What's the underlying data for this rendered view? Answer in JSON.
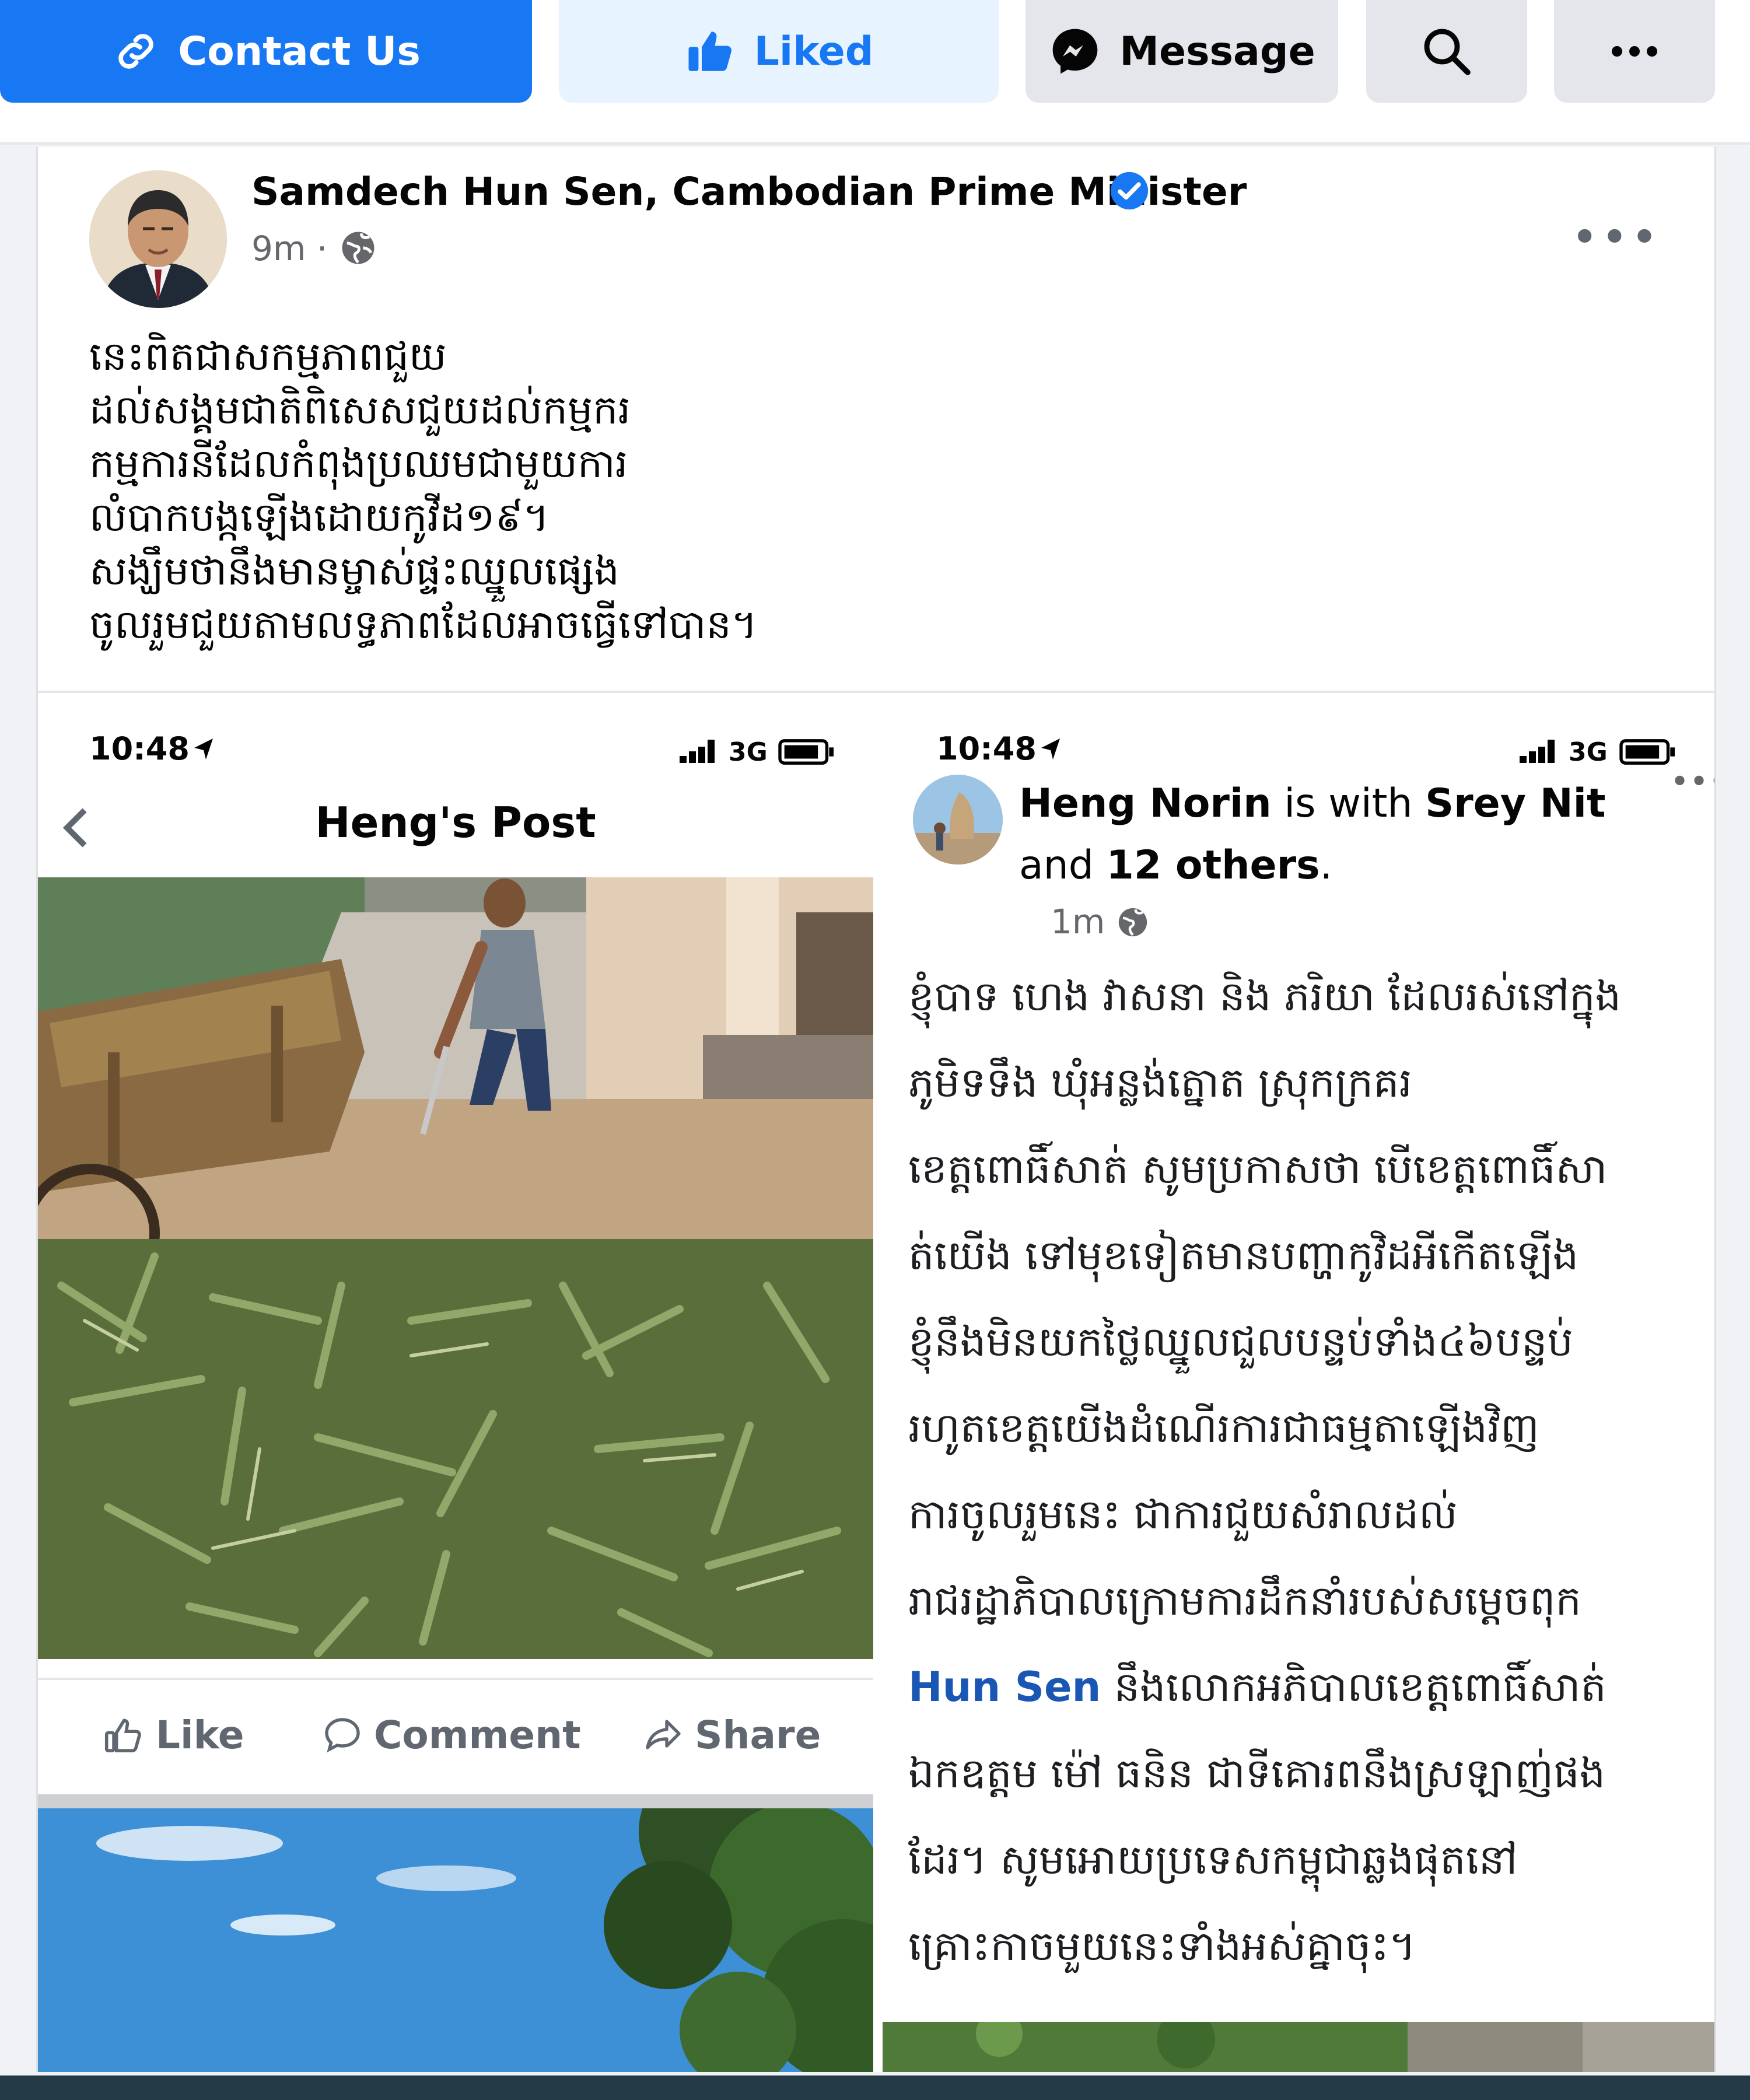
{
  "top_buttons": {
    "contact": "Contact Us",
    "liked": "Liked",
    "message": "Message"
  },
  "post": {
    "author": "Samdech Hun Sen, Cambodian Prime Minister",
    "time": "9m ·",
    "body_lines": [
      "នេះពិតជាសកម្មភាពជួយ",
      "ដល់សង្គមជាតិពិសេសជួយដល់កម្មករ",
      "កម្មការនីដែលកំពុងប្រឈមជាមួយការ",
      "លំបាកបង្កឡើងដោយកូវីដ១៩។",
      "សង្ឃឹមថានឹងមានម្ចាស់ផ្ទះឈ្នួលផ្សេង",
      "ចូលរួមជួយតាមលទ្ធភាពដែលអាចធ្វើទៅបាន។"
    ]
  },
  "left_screenshot": {
    "status_time": "10:48",
    "network": "3G",
    "title": "Heng's Post",
    "actions": {
      "like": "Like",
      "comment": "Comment",
      "share": "Share"
    }
  },
  "right_screenshot": {
    "status_time": "10:48",
    "network": "3G",
    "author": "Heng Norin",
    "with_text": " is with ",
    "tagged": "Srey Nit",
    "and_text": "and ",
    "others": "12 others",
    "period": ".",
    "time": "1m ·",
    "lines": [
      "ខ្ញុំបាទ ហេង វាសនា និង ភរិយា ដែលរស់នៅក្នុង",
      "ភូមិទទឹង ឃុំអន្លង់ត្នោត ស្រុកក្រគរ",
      "ខេត្តពោធិ៍សាត់ សូមប្រកាសថា បើខេត្តពោធិ៍សា",
      "ត់យើង  ទៅមុខទៀតមានបញ្ហាកូវិដអីកើតឡើង",
      "ខ្ញុំនឹងមិនយកថ្លៃឈ្នួលជួលបន្ទប់ទាំង៤៦បន្ទប់",
      "រហូតខេត្តយើងដំណើរការជាធម្មតាឡើងវិញ",
      "ការចូលរួមនេះ ជាការជួយសំរាលដល់",
      "រាជរដ្ឋាភិបាលក្រោមការដឹកនាំរបស់សម្តេចពុក",
      "នឹងលោកអភិបាលខេត្តពោធិ៍សាត់",
      "ឯកឧត្តម ម៉ៅ ធនិន ជាទីគោរពនឹងស្រឡាញ់ផង",
      "ដែរ។ សូមអោយប្រទេសកម្ពុជាឆ្លងផុតនៅ",
      "គ្រោះកាចមួយនេះទាំងអស់គ្នាចុះ។"
    ],
    "mention": "Hun Sen"
  },
  "colors": {
    "brand_blue": "#1877f2",
    "liked_bg": "#e7f3ff",
    "neutral_button": "#e4e6eb",
    "mention_blue": "#1a56b3"
  },
  "icons": [
    "link-icon",
    "thumbs-up-icon",
    "messenger-icon",
    "search-icon",
    "more-icon",
    "verified-icon",
    "globe-icon",
    "back-arrow-icon",
    "comment-icon",
    "share-icon"
  ]
}
